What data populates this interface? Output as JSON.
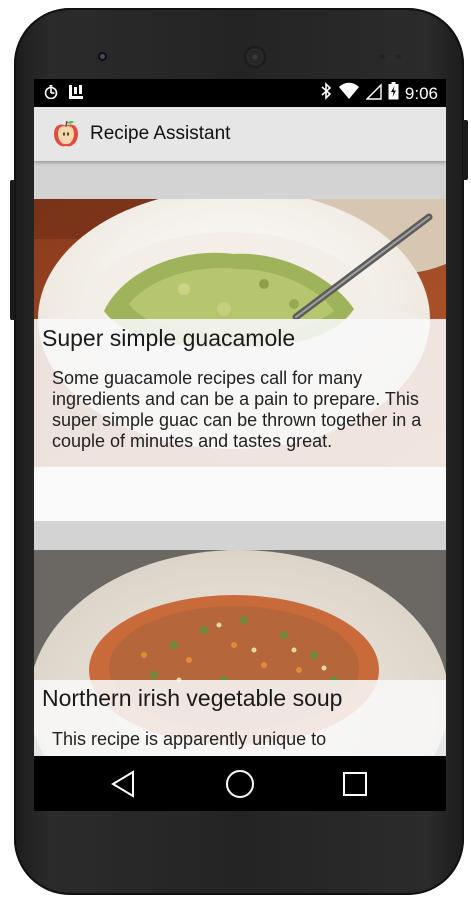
{
  "status_bar": {
    "time": "9:06",
    "icons": [
      "timer-icon",
      "app-notification-icon",
      "bluetooth-icon",
      "wifi-icon",
      "signal-icon",
      "battery-icon"
    ]
  },
  "app_bar": {
    "title": "Recipe Assistant",
    "icon": "apple-icon"
  },
  "recipes": [
    {
      "title": "Super simple guacamole",
      "description": "Some guacamole recipes call for many ingredients and can be a pain to prepare. This super simple guac can be thrown together in a couple of minutes and tastes great.",
      "image": "guacamole-bowl-image"
    },
    {
      "title": "Northern irish vegetable soup",
      "description": "This recipe is apparently unique to",
      "image": "vegetable-soup-bowl-image"
    }
  ],
  "nav_bar": {
    "buttons": [
      "back-icon",
      "home-icon",
      "recents-icon"
    ]
  },
  "colors": {
    "app_bar": "#e6e6e6",
    "content_background": "#d3d3d3",
    "card_background": "#fafafa",
    "phone_body": "#242424"
  }
}
